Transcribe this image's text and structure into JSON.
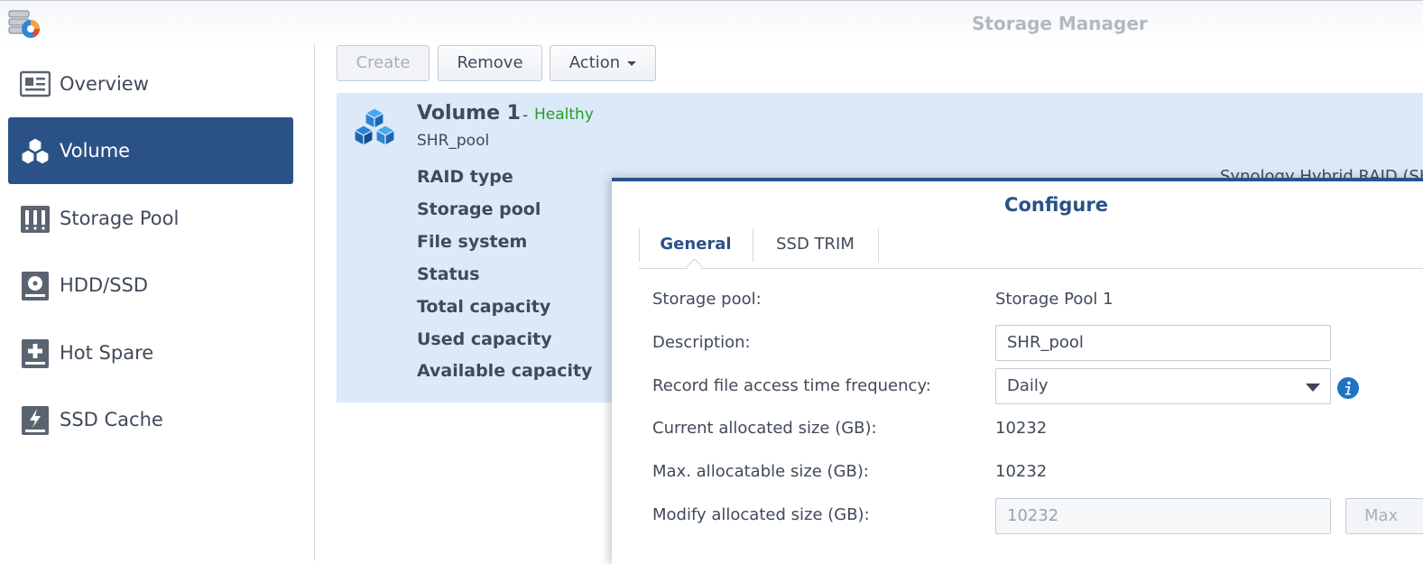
{
  "window": {
    "title": "Storage Manager",
    "app_icon": "storage-manager-icon"
  },
  "sidebar": {
    "items": [
      {
        "label": "Overview",
        "icon": "overview-icon",
        "active": false
      },
      {
        "label": "Volume",
        "icon": "volume-icon",
        "active": true
      },
      {
        "label": "Storage Pool",
        "icon": "storage-pool-icon",
        "active": false
      },
      {
        "label": "HDD/SSD",
        "icon": "hdd-icon",
        "active": false
      },
      {
        "label": "Hot Spare",
        "icon": "hot-spare-icon",
        "active": false
      },
      {
        "label": "SSD Cache",
        "icon": "ssd-cache-icon",
        "active": false
      }
    ]
  },
  "toolbar": {
    "create_label": "Create",
    "remove_label": "Remove",
    "action_label": "Action"
  },
  "volume": {
    "name": "Volume 1",
    "separator": "-",
    "status": "Healthy",
    "description": "SHR_pool",
    "properties": [
      "RAID type",
      "Storage pool",
      "File system",
      "Status",
      "Total capacity",
      "Used capacity",
      "Available capacity"
    ],
    "raid_type_value": "Synology Hybrid RAID (SHR)"
  },
  "dialog": {
    "title": "Configure",
    "tabs": [
      {
        "label": "General",
        "active": true
      },
      {
        "label": "SSD TRIM",
        "active": false
      }
    ],
    "fields": {
      "storage_pool_label": "Storage pool:",
      "storage_pool_value": "Storage Pool 1",
      "description_label": "Description:",
      "description_value": "SHR_pool",
      "access_time_label": "Record file access time frequency:",
      "access_time_value": "Daily",
      "current_size_label": "Current allocated size (GB):",
      "current_size_value": "10232",
      "max_size_label": "Max. allocatable size (GB):",
      "max_size_value": "10232",
      "modify_size_label": "Modify allocated size (GB):",
      "modify_size_placeholder": "10232",
      "max_button_label": "Max"
    }
  },
  "colors": {
    "accent": "#2a5287",
    "panel_bg": "#dce9f8",
    "healthy": "#23a026",
    "info": "#1f72c4"
  }
}
